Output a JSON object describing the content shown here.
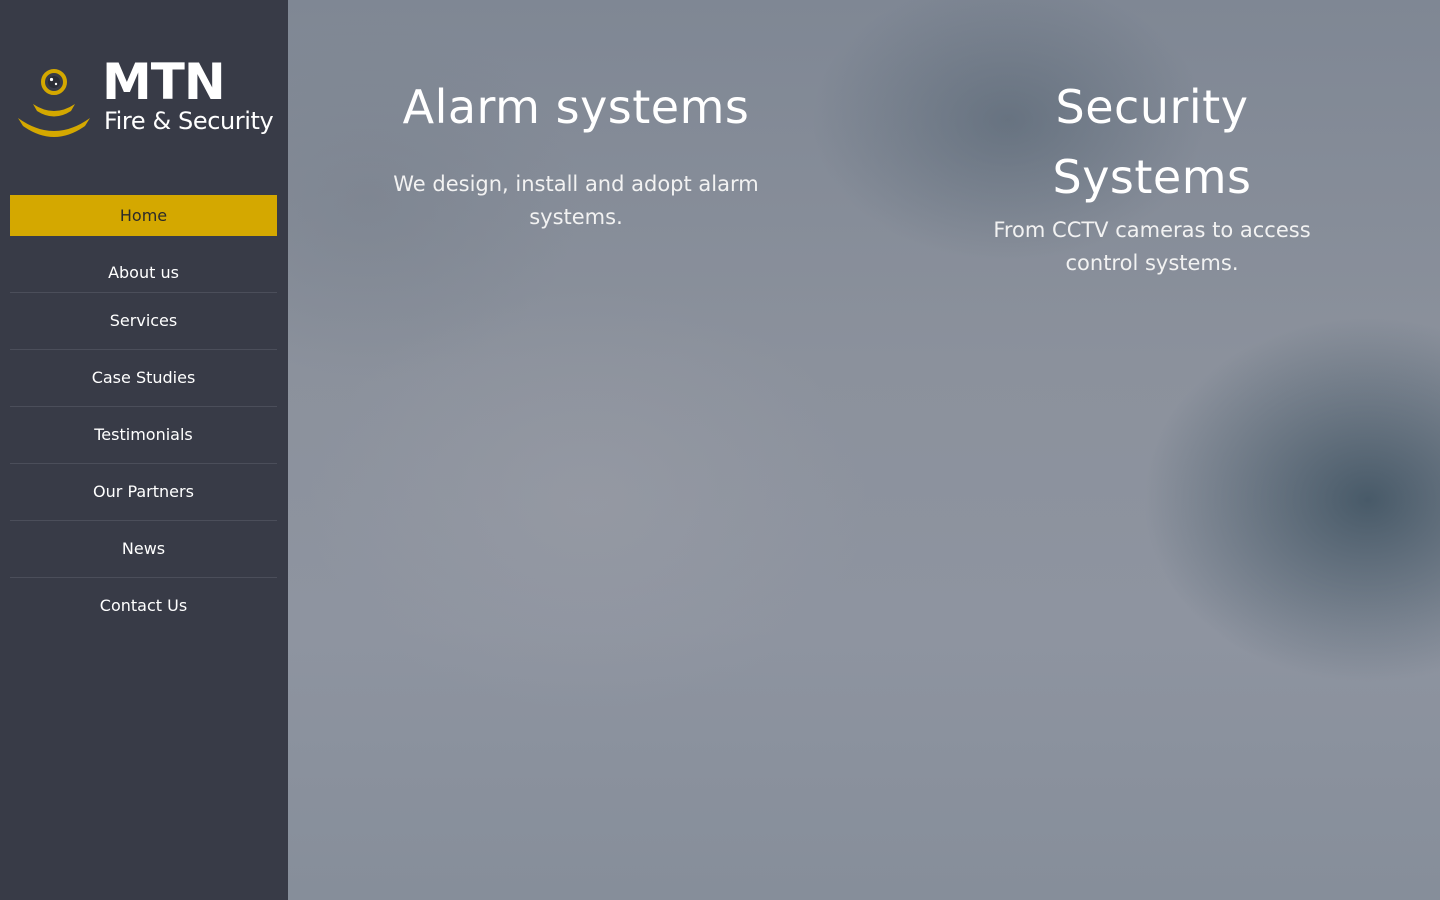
{
  "brand": {
    "title": "MTN",
    "subtitle": "Fire & Security",
    "accent_color": "#d4a800",
    "sidebar_color": "#383b47",
    "logo_icon": "camera-signal-icon"
  },
  "nav": {
    "items": [
      {
        "label": "Home",
        "active": true
      },
      {
        "label": "About us"
      },
      {
        "label": "Services"
      },
      {
        "label": "Case Studies"
      },
      {
        "label": "Testimonials"
      },
      {
        "label": "Our Partners"
      },
      {
        "label": "News"
      },
      {
        "label": "Contact Us"
      }
    ]
  },
  "features": [
    {
      "title": "Alarm systems",
      "description": "We design, install and adopt alarm systems."
    },
    {
      "title": "Security Systems",
      "description": "From CCTV cameras to access control systems."
    }
  ]
}
